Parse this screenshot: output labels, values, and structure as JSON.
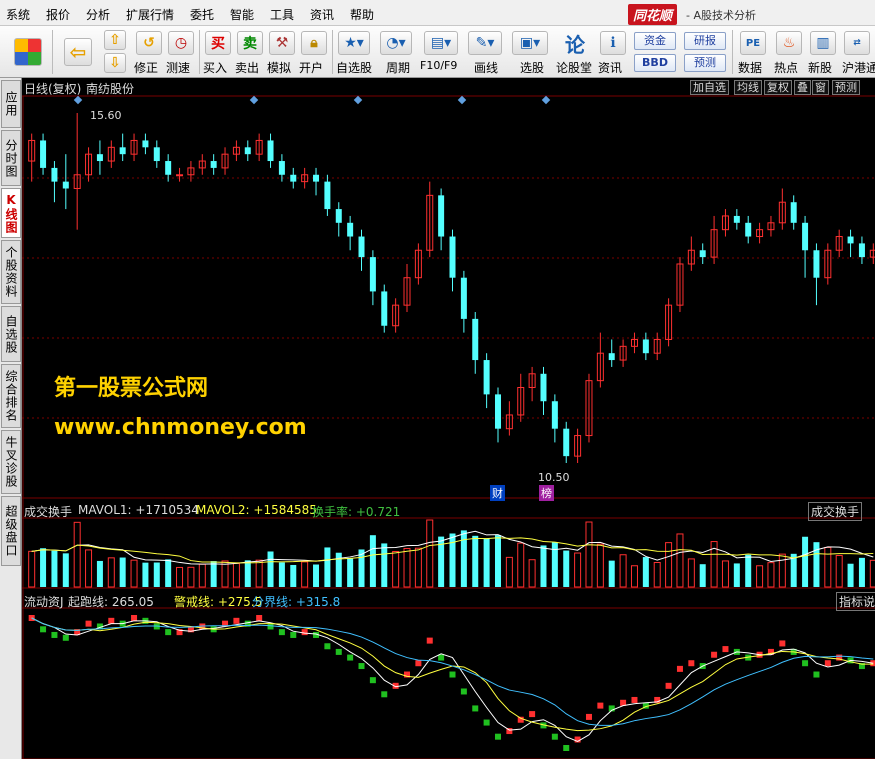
{
  "menu": [
    "系统",
    "报价",
    "分析",
    "扩展行情",
    "委托",
    "智能",
    "工具",
    "资讯",
    "帮助"
  ],
  "brand": {
    "logo": "同花顺",
    "subtitle": "- A股技术分析"
  },
  "toolbar": {
    "buttons": [
      {
        "label": "",
        "icon": "grid-icon"
      },
      {
        "label": "",
        "icon": "back-arrow-icon"
      },
      {
        "label": "",
        "icon": "up-down-icon"
      },
      {
        "label": "修正",
        "icon": "refresh-icon"
      },
      {
        "label": "测速",
        "icon": "clock-icon"
      },
      {
        "label": "买入",
        "icon": "buy-icon",
        "glyph": "买"
      },
      {
        "label": "卖出",
        "icon": "sell-icon",
        "glyph": "卖"
      },
      {
        "label": "模拟",
        "icon": "hammer-icon"
      },
      {
        "label": "开户",
        "icon": "lock-icon"
      },
      {
        "label": "自选股",
        "icon": "star-icon"
      },
      {
        "label": "周期",
        "icon": "cycle-icon"
      },
      {
        "label": "F10/F9",
        "icon": "f10-icon"
      },
      {
        "label": "画线",
        "icon": "pen-icon"
      },
      {
        "label": "选股",
        "icon": "monitor-icon"
      },
      {
        "label": "论股堂",
        "icon": "forum-icon",
        "glyph": "论"
      },
      {
        "label": "资讯",
        "icon": "info-icon"
      },
      {
        "label": "数据",
        "icon": "pe-icon",
        "glyph": "PE"
      },
      {
        "label": "热点",
        "icon": "fire-icon"
      },
      {
        "label": "新股",
        "icon": "newstock-icon"
      },
      {
        "label": "沪港通",
        "icon": "shhk-icon"
      }
    ],
    "pills": [
      "资金",
      "研报",
      "BBD",
      "预测"
    ]
  },
  "sidetabs": [
    {
      "label": "应用",
      "active": false
    },
    {
      "label": "分时图",
      "active": false
    },
    {
      "label": "K线图",
      "active": true
    },
    {
      "label": "个股资料",
      "active": false
    },
    {
      "label": "自选股",
      "active": false
    },
    {
      "label": "综合排名",
      "active": false
    },
    {
      "label": "牛叉诊股",
      "active": false
    },
    {
      "label": "超级盘口",
      "active": false
    }
  ],
  "kline": {
    "title": "日线(复权)",
    "stock": "南纺股份",
    "buttons": [
      "加自选",
      "均线",
      "复权",
      "叠",
      "窗",
      "预测"
    ],
    "high_label": "15.60",
    "low_label": "10.50",
    "markers": [
      "财",
      "榜"
    ]
  },
  "volume": {
    "title": "成交换手",
    "mavol1": "MAVOL1: +1710534",
    "mavol2": "MAVOL2: +1584585",
    "turnover": "换手率: +0.721",
    "right_label": "成交换手"
  },
  "indicator": {
    "title": "流动资J",
    "start": "起跑线: 265.05",
    "warn": "警戒线: +275.5",
    "divide": "分界线: +315.8",
    "right_label": "指标说",
    "signals": [
      "贴",
      "贴",
      "贴",
      "贴",
      "贴"
    ]
  },
  "watermark": {
    "line1": "第一股票公式网",
    "line2": "www.chnmoney.com"
  },
  "colors": {
    "up": "#ff3030",
    "down": "#54ffff",
    "ma_white": "#ffffff",
    "ma_yellow": "#ffff40",
    "ma_cyan": "#40c0ff",
    "grid": "#7a0000",
    "watermark": "#ffd200"
  },
  "chart_data": {
    "type": "candlestick",
    "price_range": [
      10.5,
      15.6
    ],
    "candles": [
      [
        14.9,
        15.2,
        15.3,
        14.6
      ],
      [
        15.2,
        14.8,
        15.3,
        14.7
      ],
      [
        14.8,
        14.6,
        14.9,
        14.3
      ],
      [
        14.6,
        14.5,
        15.0,
        14.2
      ],
      [
        14.5,
        14.7,
        15.6,
        13.9
      ],
      [
        14.7,
        15.0,
        15.1,
        14.6
      ],
      [
        15.0,
        14.9,
        15.2,
        14.7
      ],
      [
        14.9,
        15.1,
        15.2,
        14.8
      ],
      [
        15.1,
        15.0,
        15.3,
        14.9
      ],
      [
        15.0,
        15.2,
        15.3,
        14.9
      ],
      [
        15.2,
        15.1,
        15.3,
        15.0
      ],
      [
        15.1,
        14.9,
        15.2,
        14.8
      ],
      [
        14.9,
        14.7,
        15.0,
        14.6
      ],
      [
        14.7,
        14.7,
        14.8,
        14.6
      ],
      [
        14.7,
        14.8,
        14.9,
        14.6
      ],
      [
        14.8,
        14.9,
        15.0,
        14.7
      ],
      [
        14.9,
        14.8,
        15.0,
        14.7
      ],
      [
        14.8,
        15.0,
        15.1,
        14.7
      ],
      [
        15.0,
        15.1,
        15.2,
        14.9
      ],
      [
        15.1,
        15.0,
        15.2,
        14.9
      ],
      [
        15.0,
        15.2,
        15.3,
        14.9
      ],
      [
        15.2,
        14.9,
        15.3,
        14.8
      ],
      [
        14.9,
        14.7,
        15.0,
        14.6
      ],
      [
        14.7,
        14.6,
        14.8,
        14.5
      ],
      [
        14.6,
        14.7,
        14.8,
        14.5
      ],
      [
        14.7,
        14.6,
        14.8,
        14.4
      ],
      [
        14.6,
        14.2,
        14.7,
        14.1
      ],
      [
        14.2,
        14.0,
        14.3,
        13.8
      ],
      [
        14.0,
        13.8,
        14.1,
        13.6
      ],
      [
        13.8,
        13.5,
        13.9,
        13.3
      ],
      [
        13.5,
        13.0,
        13.6,
        12.8
      ],
      [
        13.0,
        12.5,
        13.1,
        12.4
      ],
      [
        12.5,
        12.8,
        12.9,
        12.4
      ],
      [
        12.8,
        13.2,
        13.4,
        12.7
      ],
      [
        13.2,
        13.6,
        13.7,
        13.1
      ],
      [
        13.6,
        14.4,
        14.6,
        13.5
      ],
      [
        14.4,
        13.8,
        14.5,
        13.6
      ],
      [
        13.8,
        13.2,
        13.9,
        13.0
      ],
      [
        13.2,
        12.6,
        13.3,
        12.4
      ],
      [
        12.6,
        12.0,
        12.7,
        11.8
      ],
      [
        12.0,
        11.5,
        12.1,
        11.3
      ],
      [
        11.5,
        11.0,
        11.6,
        10.8
      ],
      [
        11.0,
        11.2,
        11.4,
        10.9
      ],
      [
        11.2,
        11.6,
        11.8,
        11.1
      ],
      [
        11.6,
        11.8,
        11.9,
        11.4
      ],
      [
        11.8,
        11.4,
        11.9,
        11.2
      ],
      [
        11.4,
        11.0,
        11.5,
        10.8
      ],
      [
        11.0,
        10.6,
        11.1,
        10.5
      ],
      [
        10.6,
        10.9,
        11.0,
        10.5
      ],
      [
        10.9,
        11.7,
        11.8,
        10.8
      ],
      [
        11.7,
        12.1,
        12.4,
        11.6
      ],
      [
        12.1,
        12.0,
        12.3,
        11.9
      ],
      [
        12.0,
        12.2,
        12.3,
        11.9
      ],
      [
        12.2,
        12.3,
        12.4,
        12.1
      ],
      [
        12.3,
        12.1,
        12.4,
        12.0
      ],
      [
        12.1,
        12.3,
        12.4,
        12.0
      ],
      [
        12.3,
        12.8,
        12.9,
        12.2
      ],
      [
        12.8,
        13.4,
        13.5,
        12.7
      ],
      [
        13.4,
        13.6,
        13.8,
        13.3
      ],
      [
        13.6,
        13.5,
        13.7,
        13.4
      ],
      [
        13.5,
        13.9,
        14.1,
        13.4
      ],
      [
        13.9,
        14.1,
        14.2,
        13.8
      ],
      [
        14.1,
        14.0,
        14.2,
        13.9
      ],
      [
        14.0,
        13.8,
        14.1,
        13.7
      ],
      [
        13.8,
        13.9,
        14.0,
        13.7
      ],
      [
        13.9,
        14.0,
        14.1,
        13.8
      ],
      [
        14.0,
        14.3,
        14.5,
        13.9
      ],
      [
        14.3,
        14.0,
        14.4,
        13.9
      ],
      [
        14.0,
        13.6,
        14.1,
        13.2
      ],
      [
        13.6,
        13.2,
        13.7,
        12.8
      ],
      [
        13.2,
        13.6,
        13.7,
        13.1
      ],
      [
        13.6,
        13.8,
        13.9,
        13.5
      ],
      [
        13.8,
        13.7,
        13.9,
        13.5
      ],
      [
        13.7,
        13.5,
        13.8,
        13.4
      ],
      [
        13.5,
        13.6,
        13.7,
        13.4
      ]
    ]
  }
}
